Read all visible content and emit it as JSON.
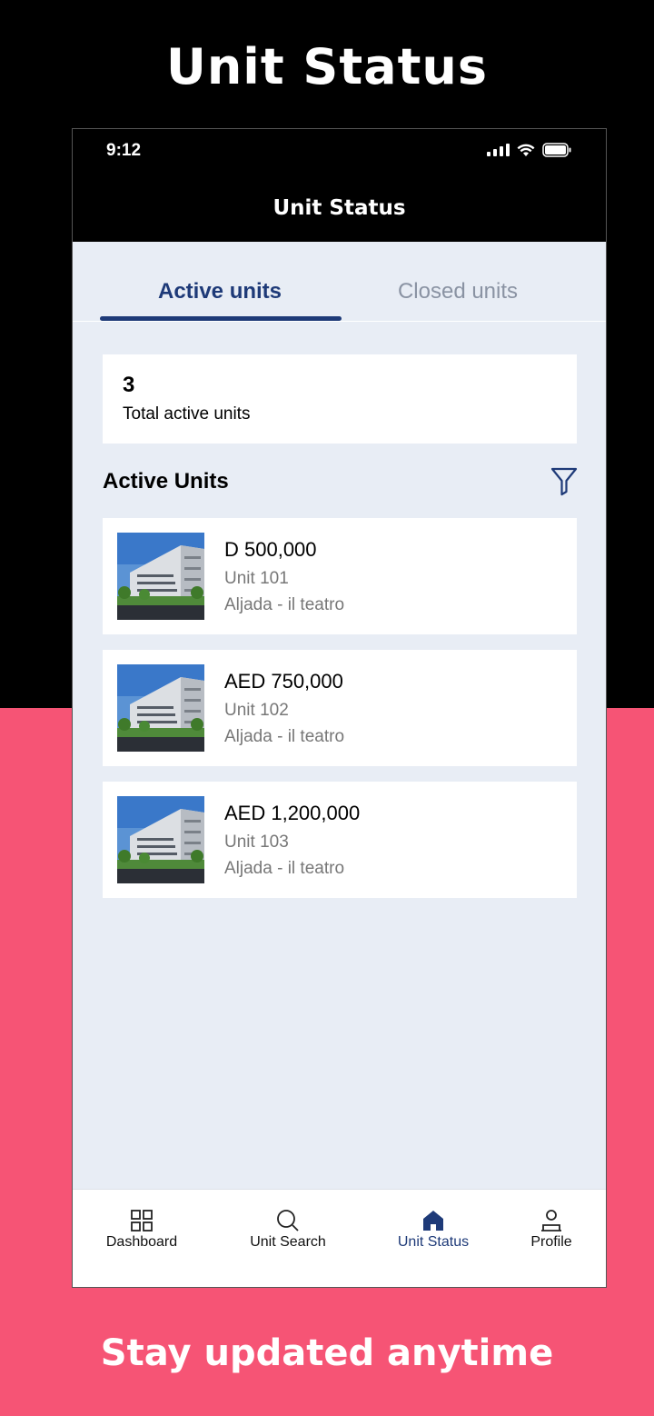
{
  "hero": {
    "title": "Unit Status",
    "tagline": "Stay updated anytime"
  },
  "status_bar": {
    "time": "9:12"
  },
  "header": {
    "title": "Unit Status"
  },
  "tabs": [
    {
      "label": "Active units",
      "active": true
    },
    {
      "label": "Closed units",
      "active": false
    }
  ],
  "summary": {
    "count": "3",
    "label": "Total active units"
  },
  "section": {
    "title": "Active Units"
  },
  "units": [
    {
      "price": "D 500,000",
      "unit": "Unit 101",
      "project": "Aljada - il teatro"
    },
    {
      "price": "AED 750,000",
      "unit": "Unit 102",
      "project": "Aljada - il teatro"
    },
    {
      "price": "AED 1,200,000",
      "unit": "Unit 103",
      "project": "Aljada - il teatro"
    }
  ],
  "nav": [
    {
      "label": "Dashboard",
      "icon": "grid-icon"
    },
    {
      "label": "Unit Search",
      "icon": "search-icon"
    },
    {
      "label": "Unit Status",
      "icon": "home-icon",
      "active": true
    },
    {
      "label": "Profile",
      "icon": "user-icon"
    }
  ],
  "colors": {
    "accent": "#1e3a78",
    "background_pink": "#f65475",
    "screen_bg": "#e8edf5"
  }
}
